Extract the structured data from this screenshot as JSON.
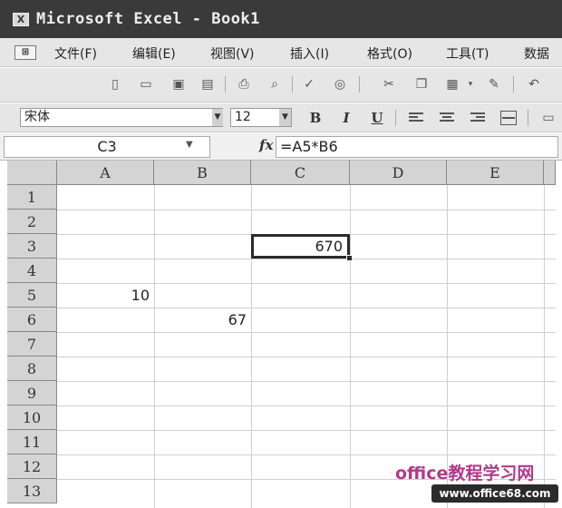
{
  "window": {
    "title": "Microsoft Excel - Book1",
    "icon": "excel-app-icon"
  },
  "menu": {
    "items": [
      "文件(F)",
      "编辑(E)",
      "视图(V)",
      "插入(I)",
      "格式(O)",
      "工具(T)",
      "数据"
    ]
  },
  "toolbar": {
    "buttons": [
      "new-icon",
      "open-icon",
      "save-icon",
      "permission-icon",
      "print-icon",
      "print-preview-icon",
      "spelling-icon",
      "research-icon",
      "cut-icon",
      "copy-icon",
      "paste-icon",
      "format-painter-icon",
      "undo-icon"
    ]
  },
  "format_toolbar": {
    "font_name": "宋体",
    "font_size": "12",
    "bold": "B",
    "italic": "I",
    "underline": "U"
  },
  "formula_bar": {
    "name_box": "C3",
    "fx_label": "fx",
    "formula": "=A5*B6"
  },
  "sheet": {
    "columns": [
      "A",
      "B",
      "C",
      "D",
      "E"
    ],
    "rows": [
      "1",
      "2",
      "3",
      "4",
      "5",
      "6",
      "7",
      "8",
      "9",
      "10",
      "11",
      "12",
      "13"
    ],
    "cells": {
      "A5": "10",
      "B6": "67",
      "C3": "670"
    },
    "active_cell": "C3"
  },
  "watermark": {
    "text": "office教程学习网",
    "logo": "www.office68.com"
  }
}
